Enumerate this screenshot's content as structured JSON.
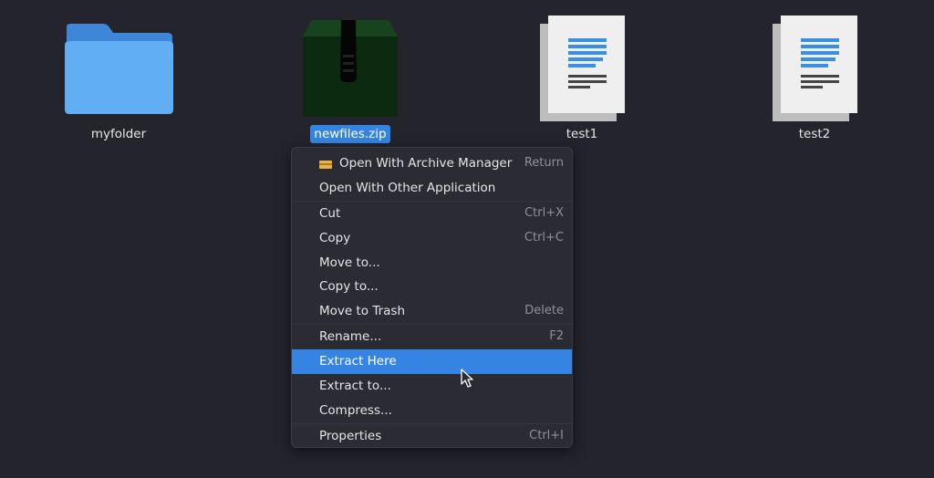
{
  "files": [
    {
      "name": "myfolder",
      "icon": "folder-icon",
      "selected": false
    },
    {
      "name": "newfiles.zip",
      "icon": "archive-icon",
      "selected": true
    },
    {
      "name": "test1",
      "icon": "text-document-icon",
      "selected": false
    },
    {
      "name": "test2",
      "icon": "text-document-icon",
      "selected": false
    }
  ],
  "context_menu": {
    "items": [
      {
        "label": "Open With Archive Manager",
        "accel": "Return",
        "icon": "archive-manager-icon"
      },
      {
        "label": "Open With Other Application",
        "accel": ""
      },
      {
        "label": "Cut",
        "accel": "Ctrl+X"
      },
      {
        "label": "Copy",
        "accel": "Ctrl+C"
      },
      {
        "label": "Move to...",
        "accel": ""
      },
      {
        "label": "Copy to...",
        "accel": ""
      },
      {
        "label": "Move to Trash",
        "accel": "Delete"
      },
      {
        "label": "Rename...",
        "accel": "F2"
      },
      {
        "label": "Extract Here",
        "accel": "",
        "highlighted": true
      },
      {
        "label": "Extract to...",
        "accel": ""
      },
      {
        "label": "Compress...",
        "accel": ""
      },
      {
        "label": "Properties",
        "accel": "Ctrl+I"
      }
    ]
  },
  "colors": {
    "background": "#23242c",
    "selection": "#3584e4",
    "folder": "#5aa9f0",
    "menu_bg": "#2a2b33"
  }
}
